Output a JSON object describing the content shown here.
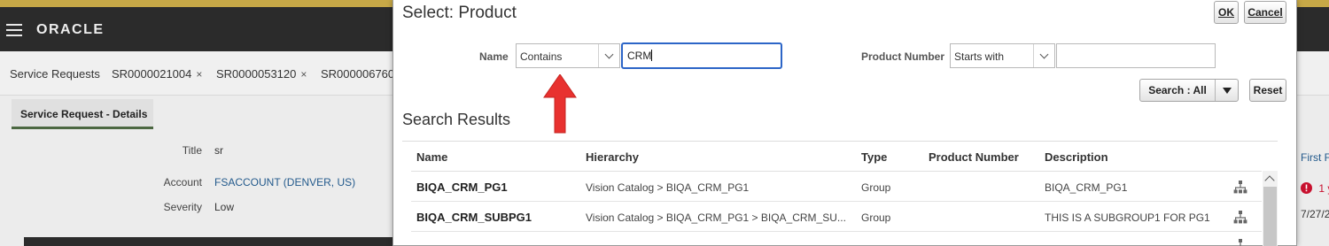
{
  "app": {
    "logo": "ORACLE",
    "tabs": [
      {
        "label": "Service Requests",
        "closable": false
      },
      {
        "label": "SR0000021004",
        "closable": true
      },
      {
        "label": "SR0000053120",
        "closable": true
      },
      {
        "label": "SR000006760",
        "closable": false
      }
    ],
    "close_glyph": "×",
    "subtab": "Service Request - Details",
    "fields": [
      {
        "label": "Title",
        "value": "sr"
      },
      {
        "label": "Account",
        "value": "FSACCOUNT (DENVER, US)"
      },
      {
        "label": "Severity",
        "value": "Low"
      }
    ],
    "right_cut": {
      "first": "First F",
      "warn": "1 y",
      "date": "7/27/2"
    }
  },
  "dialog": {
    "title": "Select: Product",
    "ok_label": "OK",
    "cancel_label": "Cancel",
    "name_label": "Name",
    "name_operator": "Contains",
    "name_value": "CRM",
    "product_number_label": "Product Number",
    "product_number_operator": "Starts with",
    "product_number_value": "",
    "search_label": "Search : All",
    "reset_label": "Reset",
    "results_title": "Search Results",
    "columns": [
      "Name",
      "Hierarchy",
      "Type",
      "Product Number",
      "Description"
    ],
    "rows": [
      {
        "name": "BIQA_CRM_PG1",
        "hierarchy": "Vision Catalog > BIQA_CRM_PG1",
        "type": "Group",
        "product_number": "",
        "description": "BIQA_CRM_PG1"
      },
      {
        "name": "BIQA_CRM_SUBPG1",
        "hierarchy": "Vision Catalog > BIQA_CRM_PG1 > BIQA_CRM_SU...",
        "type": "Group",
        "product_number": "",
        "description": "THIS IS A SUBGROUP1 FOR PG1"
      }
    ]
  },
  "colors": {
    "accent_gold": "#c7a847",
    "topbar": "#2b2b2b",
    "focus_blue": "#2c65c7",
    "annotation_red": "#e8312f",
    "link": "#235a8c"
  },
  "icons": {
    "menu": "hamburger-icon",
    "hierarchy": "hierarchy-icon",
    "warning": "error-icon",
    "annotation": "red-arrow-annotation"
  }
}
